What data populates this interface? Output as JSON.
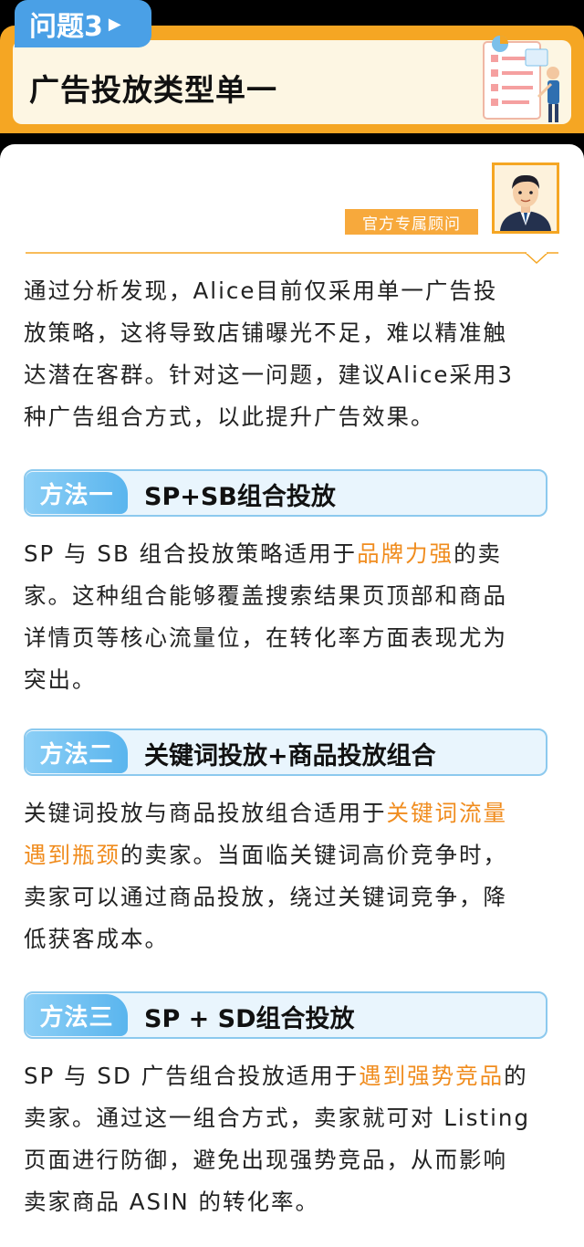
{
  "header": {
    "tag": "问题3",
    "title": "广告投放类型单一"
  },
  "advisor": {
    "label": "官方专属顾问"
  },
  "intro": {
    "lines": [
      "通过分析发现，Alice目前仅采用单一广告投",
      "放策略，这将导致店铺曝光不足，难以精准触",
      "达潜在客群。针对这一问题，建议Alice采用3",
      "种广告组合方式，以此提升广告效果。"
    ]
  },
  "methods": [
    {
      "label": "方法一",
      "title": "SP+SB组合投放",
      "body": {
        "l1a": "SP 与 SB 组合投放策略适用于",
        "l1h": "品牌力强",
        "l1b": "的卖",
        "l2": "家。这种组合能够覆盖搜索结果页顶部和商品",
        "l3": "详情页等核心流量位，在转化率方面表现尤为",
        "l4": "突出。"
      }
    },
    {
      "label": "方法二",
      "title": "关键词投放+商品投放组合",
      "body": {
        "l1a": "关键词投放与商品投放组合适用于",
        "l1h": "关键词流量",
        "l2h": "遇到瓶颈",
        "l2b": "的卖家。当面临关键词高价竞争时，",
        "l3": "卖家可以通过商品投放，绕过关键词竞争，降",
        "l4": "低获客成本。"
      }
    },
    {
      "label": "方法三",
      "title": "SP + SD组合投放",
      "body": {
        "l1a": "SP 与 SD 广告组合投放适用于",
        "l1h": "遇到强势竞品",
        "l1b": "的",
        "l2": "卖家。通过这一组合方式，卖家就可对 Listing",
        "l3": "页面进行防御，避免出现强势竞品，从而影响",
        "l4": "卖家商品 ASIN 的转化率。"
      }
    }
  ],
  "colors": {
    "accent_orange": "#f5a623",
    "highlight": "#f08c1e",
    "tag_blue": "#4aa0e6",
    "section_blue": "#5ab5ee"
  }
}
